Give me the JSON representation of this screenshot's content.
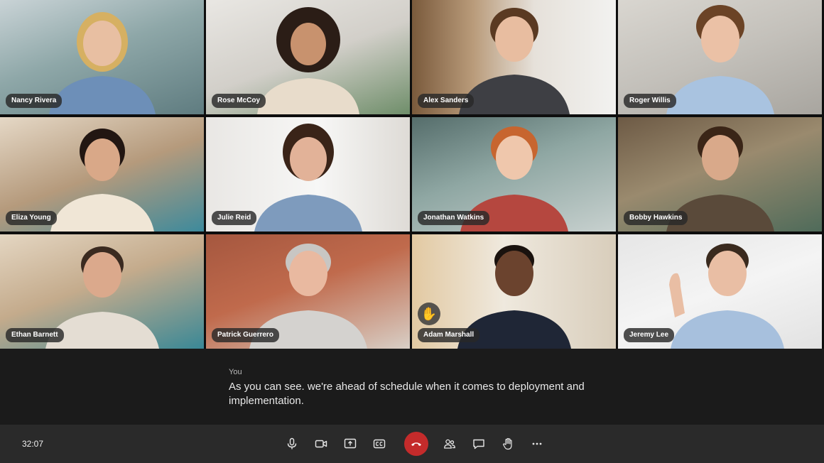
{
  "participants": [
    {
      "name": "Nancy Rivera"
    },
    {
      "name": "Rose McCoy"
    },
    {
      "name": "Alex Sanders"
    },
    {
      "name": "Roger Willis"
    },
    {
      "name": "Eliza Young"
    },
    {
      "name": "Julie Reid"
    },
    {
      "name": "Jonathan Watkins"
    },
    {
      "name": "Bobby Hawkins"
    },
    {
      "name": "Ethan Barnett"
    },
    {
      "name": "Patrick Guerrero"
    },
    {
      "name": "Adam Marshall",
      "hand_raised": true
    },
    {
      "name": "Jeremy Lee"
    }
  ],
  "raised_hand_icon": "raised-hand-icon",
  "caption": {
    "speaker": "You",
    "text": "As you can see. we're ahead of schedule when it comes to deployment and implementation."
  },
  "call": {
    "elapsed_time": "32:07"
  },
  "controls": {
    "icons": [
      "microphone-icon",
      "camera-icon",
      "share-screen-icon",
      "closed-captions-icon",
      "end-call-icon",
      "participants-icon",
      "chat-icon",
      "raise-hand-icon",
      "more-options-icon"
    ]
  },
  "colors": {
    "end_call": "#c42b2b",
    "control_bar": "#2a2a2a",
    "background": "#1b1b1b"
  }
}
